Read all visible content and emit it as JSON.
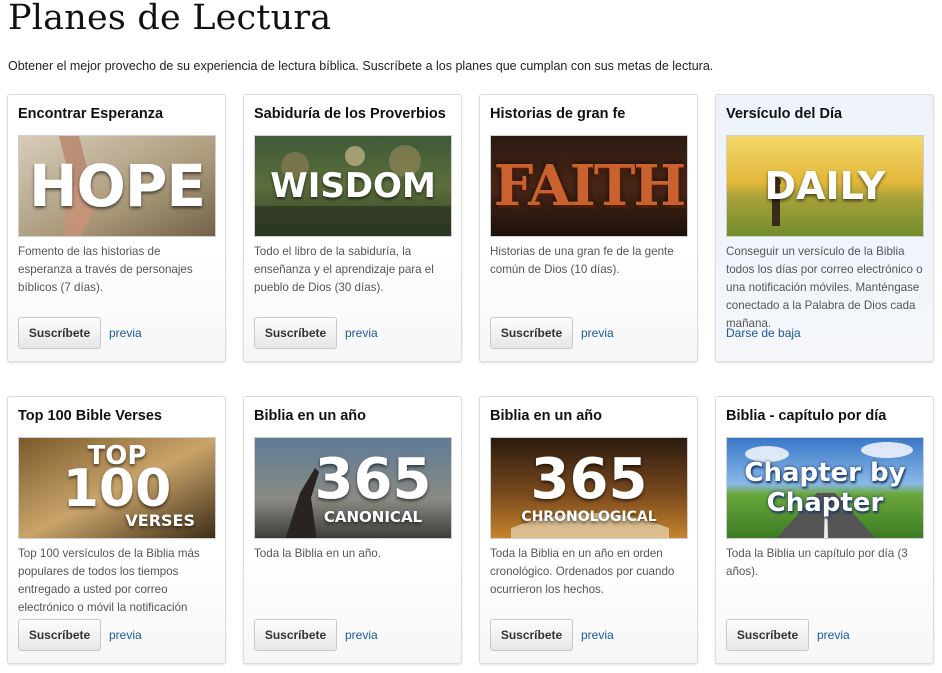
{
  "page": {
    "title": "Planes de Lectura",
    "subtitle": "Obtener el mejor provecho de su experiencia de lectura bíblica. Suscríbete a los planes que cumplan con sus metas de lectura."
  },
  "plans": [
    {
      "title": "Encontrar Esperanza",
      "image_text": "HOPE",
      "description": "Fomento de las historias de esperanza a través de personajes bíblicos (7 días).",
      "subscribe_label": "Suscríbete",
      "preview_label": "previa"
    },
    {
      "title": "Sabiduría de los Proverbios",
      "image_text": "WISDOM",
      "description": "Todo el libro de la sabiduría, la enseñanza y el aprendizaje para el pueblo de Dios (30 días).",
      "subscribe_label": "Suscríbete",
      "preview_label": "previa"
    },
    {
      "title": "Historias de gran fe",
      "image_text": "FAITH",
      "description": "Historias de una gran fe de la gente común de Dios (10 días).",
      "subscribe_label": "Suscríbete",
      "preview_label": "previa"
    },
    {
      "title": "Versículo del Día",
      "image_text": "DAILY",
      "description": "Conseguir un versículo de la Biblia todos los días por correo electrónico o una notificación móviles. Manténgase conectado a la Palabra de Dios cada mañana.",
      "unsubscribe_label": "Darse de baja"
    },
    {
      "title": "Top 100 Bible Verses",
      "image_text_top": "TOP",
      "image_text_main": "100",
      "image_text_bottom": "VERSES",
      "description": "Top 100 versículos de la Biblia más populares de todos los tiempos entregado a usted por correo electrónico o móvil la notificación",
      "subscribe_label": "Suscríbete",
      "preview_label": "previa"
    },
    {
      "title": "Biblia en un año",
      "image_text_main": "365",
      "image_text_bottom": "CANONICAL",
      "description": "Toda la Biblia en un año.",
      "subscribe_label": "Suscríbete",
      "preview_label": "previa"
    },
    {
      "title": "Biblia en un año",
      "image_text_main": "365",
      "image_text_bottom": "CHRONOLOGICAL",
      "description": "Toda la Biblia en un año en orden cronológico. Ordenados por cuando ocurrieron los hechos.",
      "subscribe_label": "Suscríbete",
      "preview_label": "previa"
    },
    {
      "title": "Biblia - capítulo por día",
      "image_text_top": "Chapter by",
      "image_text_bottom": "Chapter",
      "description": "Toda la Biblia un capítulo por día (3 años).",
      "subscribe_label": "Suscríbete",
      "preview_label": "previa"
    }
  ],
  "colors": {
    "link": "#1a5aa0",
    "title": "#111111",
    "description": "#555555"
  }
}
